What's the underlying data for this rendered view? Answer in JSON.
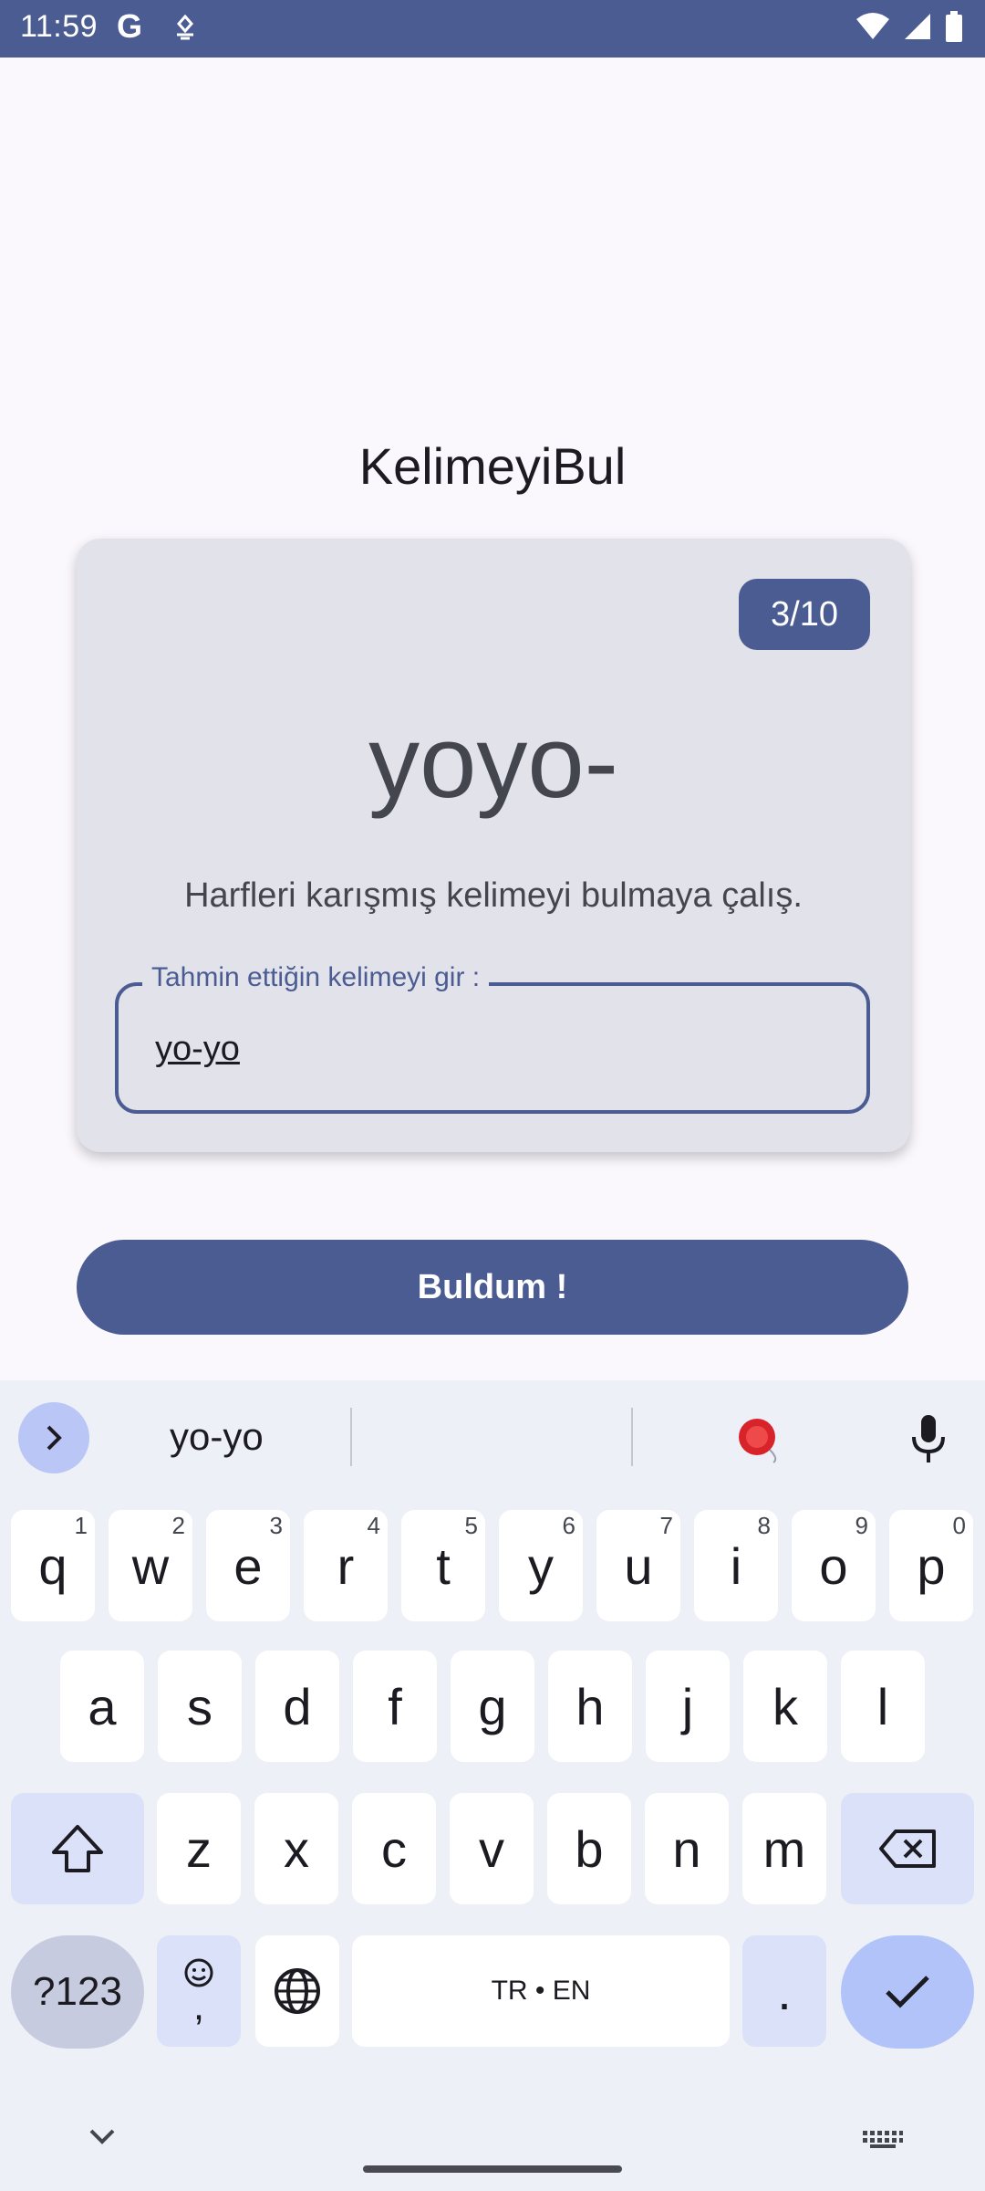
{
  "status_bar": {
    "time": "11:59",
    "g_label": "G",
    "icons": [
      "rotate-icon",
      "wifi-icon",
      "signal-icon",
      "battery-icon"
    ]
  },
  "app": {
    "title": "KelimeyiBul",
    "counter": "3/10",
    "scrambled_word": "yoyo-",
    "hint": "Harfleri karışmış kelimeyi bulmaya çalış.",
    "input": {
      "label": "Tahmin ettiğin kelimeyi gir :",
      "value": "yo-yo"
    },
    "submit_label": "Buldum !"
  },
  "keyboard": {
    "suggestion": "yo-yo",
    "row1": [
      {
        "k": "q",
        "n": "1"
      },
      {
        "k": "w",
        "n": "2"
      },
      {
        "k": "e",
        "n": "3"
      },
      {
        "k": "r",
        "n": "4"
      },
      {
        "k": "t",
        "n": "5"
      },
      {
        "k": "y",
        "n": "6"
      },
      {
        "k": "u",
        "n": "7"
      },
      {
        "k": "i",
        "n": "8"
      },
      {
        "k": "o",
        "n": "9"
      },
      {
        "k": "p",
        "n": "0"
      }
    ],
    "row2": [
      "a",
      "s",
      "d",
      "f",
      "g",
      "h",
      "j",
      "k",
      "l"
    ],
    "row3": [
      "z",
      "x",
      "c",
      "v",
      "b",
      "n",
      "m"
    ],
    "sym_label": "?123",
    "comma_label": ",",
    "space_label": "TR • EN",
    "period_label": "."
  },
  "colors": {
    "primary": "#4a5c92",
    "card": "#e2e2ea",
    "background": "#fbf8fd",
    "keyboard_bg": "#eef0f7"
  }
}
